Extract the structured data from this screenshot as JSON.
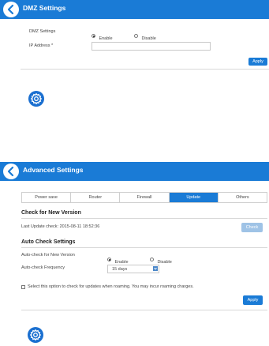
{
  "dmz": {
    "title": "DMZ Settings",
    "dmz_settings_label": "DMZ Settings",
    "enable_label": "Enable",
    "disable_label": "Disable",
    "ip_address_label": "IP Address *",
    "ip_address_value": "",
    "apply_label": "Apply"
  },
  "advanced": {
    "title": "Advanced Settings",
    "tabs": [
      {
        "label": "Power save"
      },
      {
        "label": "Router"
      },
      {
        "label": "Firewall"
      },
      {
        "label": "Update"
      },
      {
        "label": "Others"
      }
    ],
    "check_new_version_title": "Check for New Version",
    "last_update_check": "Last Update check: 2015-08-11 18:52:36",
    "check_label": "Check",
    "auto_check_title": "Auto Check Settings",
    "auto_check_label": "Auto-check for New Version",
    "enable_label": "Enable",
    "disable_label": "Disable",
    "frequency_label": "Auto-check Frequency",
    "frequency_value": "15 days",
    "roaming_text": "Select this option to check for updates when roaming. You may incur roaming charges.",
    "apply_label": "Apply"
  },
  "colors": {
    "accent": "#1a7bd6",
    "header_text": "#ffffff",
    "check_button_disabled": "#9fc3e6"
  },
  "icons": [
    "chevron-left-icon",
    "gear-icon",
    "chevron-down-icon"
  ]
}
